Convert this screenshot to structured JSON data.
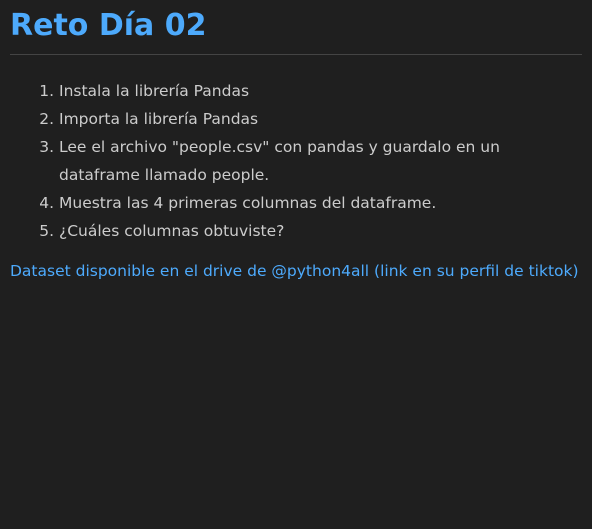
{
  "document": {
    "title": "Reto Día 02",
    "steps": [
      "Instala la librería Pandas",
      "Importa la librería Pandas",
      "Lee el archivo \"people.csv\" con pandas y guardalo en un dataframe llamado people.",
      "Muestra las 4 primeras columnas del dataframe.",
      "¿Cuáles columnas obtuviste?"
    ],
    "note": "Dataset disponible en el drive de @python4all (link en su perfil de tiktok)"
  },
  "colors": {
    "background": "#1f1f1f",
    "heading": "#4daafc",
    "text": "#cccccc",
    "link": "#4daafc",
    "rule": "#444444"
  }
}
